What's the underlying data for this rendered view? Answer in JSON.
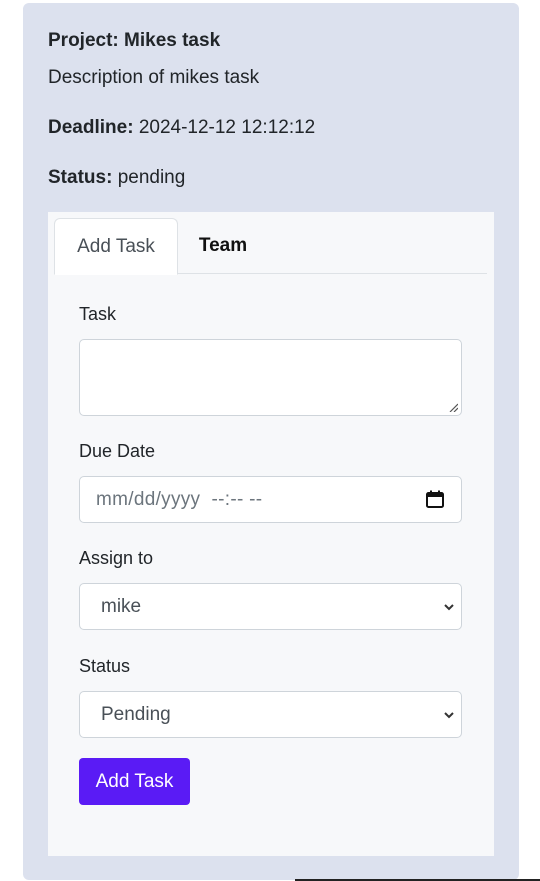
{
  "project": {
    "title": "Project: Mikes task",
    "description": "Description of mikes task",
    "deadline_label": "Deadline:",
    "deadline_value": "2024-12-12 12:12:12",
    "status_label": "Status:",
    "status_value": "pending"
  },
  "tabs": [
    {
      "label": "Add Task",
      "active": true
    },
    {
      "label": "Team",
      "active": false
    }
  ],
  "form": {
    "task_label": "Task",
    "task_value": "",
    "due_date_label": "Due Date",
    "due_date_placeholder": "mm/dd/yyyy  --:-- --",
    "assign_label": "Assign to",
    "assign_selected": "mike",
    "status_label": "Status",
    "status_selected": "Pending",
    "submit_label": "Add Task"
  },
  "colors": {
    "card_bg": "#dce1ee",
    "panel_bg": "#f7f8fa",
    "primary_button": "#5a1bf5"
  },
  "icons": {
    "date_picker": "calendar-icon",
    "select_arrow": "chevron-down-icon",
    "textarea_resize": "resize-grip-icon"
  }
}
